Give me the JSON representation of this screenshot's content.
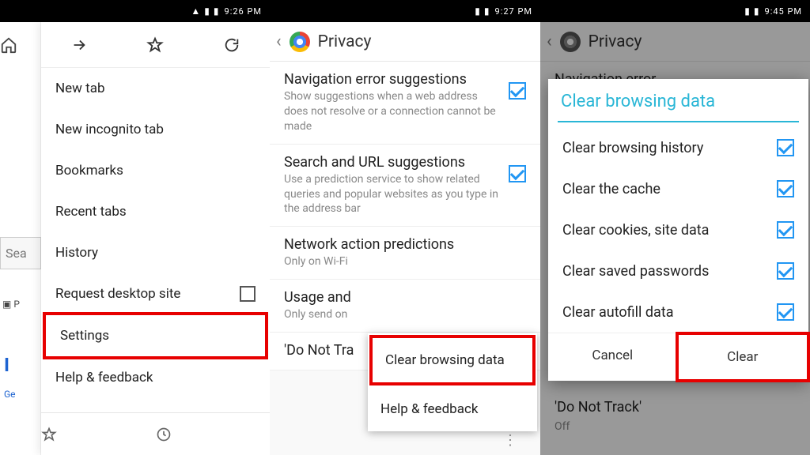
{
  "panel1": {
    "status_time": "9:26 PM",
    "search_stub": "Sea",
    "back_tab_stub": "P",
    "blue_letter": "I",
    "get_stub": "Ge",
    "menu": {
      "items": [
        "New tab",
        "New incognito tab",
        "Bookmarks",
        "Recent tabs",
        "History",
        "Request desktop site",
        "Settings",
        "Help & feedback"
      ]
    }
  },
  "panel2": {
    "status_time": "9:27 PM",
    "title": "Privacy",
    "items": [
      {
        "title": "Navigation error suggestions",
        "sub": "Show suggestions when a web address does not resolve or a connection cannot be made",
        "checked": true
      },
      {
        "title": "Search and URL suggestions",
        "sub": "Use a prediction service to show related queries and popular websites as you type in the address bar",
        "checked": true
      },
      {
        "title": "Network action predictions",
        "sub": "Only on Wi-Fi",
        "checked": false
      },
      {
        "title": "Usage and",
        "sub": "Only send on",
        "checked": false
      },
      {
        "title": "'Do Not Tra",
        "sub": "",
        "checked": false
      }
    ],
    "popup": {
      "clear": "Clear browsing data",
      "help": "Help & feedback"
    }
  },
  "panel3": {
    "status_time": "9:45 PM",
    "title": "Privacy",
    "under": "Navigation error",
    "dnt": "'Do Not Track'",
    "off": "Off",
    "dialog": {
      "title": "Clear browsing data",
      "options": [
        "Clear browsing history",
        "Clear the cache",
        "Clear cookies, site data",
        "Clear saved passwords",
        "Clear autofill data"
      ],
      "cancel": "Cancel",
      "clear": "Clear"
    }
  }
}
